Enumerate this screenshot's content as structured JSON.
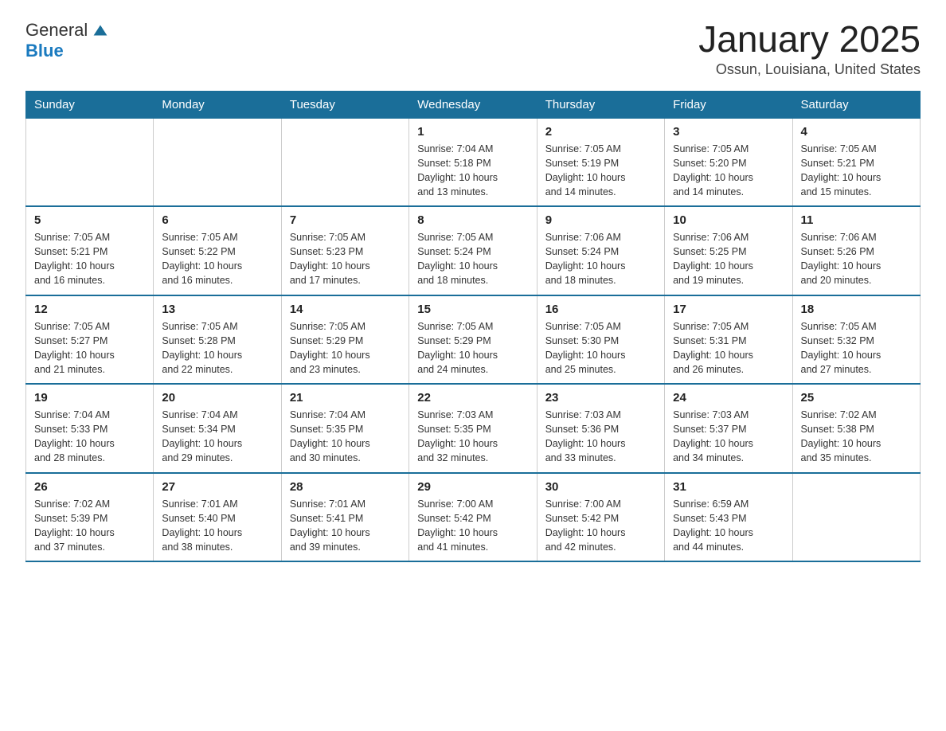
{
  "header": {
    "logo": {
      "line1": "General",
      "line2": "Blue"
    },
    "title": "January 2025",
    "location": "Ossun, Louisiana, United States"
  },
  "weekdays": [
    "Sunday",
    "Monday",
    "Tuesday",
    "Wednesday",
    "Thursday",
    "Friday",
    "Saturday"
  ],
  "weeks": [
    [
      {
        "day": "",
        "info": ""
      },
      {
        "day": "",
        "info": ""
      },
      {
        "day": "",
        "info": ""
      },
      {
        "day": "1",
        "info": "Sunrise: 7:04 AM\nSunset: 5:18 PM\nDaylight: 10 hours\nand 13 minutes."
      },
      {
        "day": "2",
        "info": "Sunrise: 7:05 AM\nSunset: 5:19 PM\nDaylight: 10 hours\nand 14 minutes."
      },
      {
        "day": "3",
        "info": "Sunrise: 7:05 AM\nSunset: 5:20 PM\nDaylight: 10 hours\nand 14 minutes."
      },
      {
        "day": "4",
        "info": "Sunrise: 7:05 AM\nSunset: 5:21 PM\nDaylight: 10 hours\nand 15 minutes."
      }
    ],
    [
      {
        "day": "5",
        "info": "Sunrise: 7:05 AM\nSunset: 5:21 PM\nDaylight: 10 hours\nand 16 minutes."
      },
      {
        "day": "6",
        "info": "Sunrise: 7:05 AM\nSunset: 5:22 PM\nDaylight: 10 hours\nand 16 minutes."
      },
      {
        "day": "7",
        "info": "Sunrise: 7:05 AM\nSunset: 5:23 PM\nDaylight: 10 hours\nand 17 minutes."
      },
      {
        "day": "8",
        "info": "Sunrise: 7:05 AM\nSunset: 5:24 PM\nDaylight: 10 hours\nand 18 minutes."
      },
      {
        "day": "9",
        "info": "Sunrise: 7:06 AM\nSunset: 5:24 PM\nDaylight: 10 hours\nand 18 minutes."
      },
      {
        "day": "10",
        "info": "Sunrise: 7:06 AM\nSunset: 5:25 PM\nDaylight: 10 hours\nand 19 minutes."
      },
      {
        "day": "11",
        "info": "Sunrise: 7:06 AM\nSunset: 5:26 PM\nDaylight: 10 hours\nand 20 minutes."
      }
    ],
    [
      {
        "day": "12",
        "info": "Sunrise: 7:05 AM\nSunset: 5:27 PM\nDaylight: 10 hours\nand 21 minutes."
      },
      {
        "day": "13",
        "info": "Sunrise: 7:05 AM\nSunset: 5:28 PM\nDaylight: 10 hours\nand 22 minutes."
      },
      {
        "day": "14",
        "info": "Sunrise: 7:05 AM\nSunset: 5:29 PM\nDaylight: 10 hours\nand 23 minutes."
      },
      {
        "day": "15",
        "info": "Sunrise: 7:05 AM\nSunset: 5:29 PM\nDaylight: 10 hours\nand 24 minutes."
      },
      {
        "day": "16",
        "info": "Sunrise: 7:05 AM\nSunset: 5:30 PM\nDaylight: 10 hours\nand 25 minutes."
      },
      {
        "day": "17",
        "info": "Sunrise: 7:05 AM\nSunset: 5:31 PM\nDaylight: 10 hours\nand 26 minutes."
      },
      {
        "day": "18",
        "info": "Sunrise: 7:05 AM\nSunset: 5:32 PM\nDaylight: 10 hours\nand 27 minutes."
      }
    ],
    [
      {
        "day": "19",
        "info": "Sunrise: 7:04 AM\nSunset: 5:33 PM\nDaylight: 10 hours\nand 28 minutes."
      },
      {
        "day": "20",
        "info": "Sunrise: 7:04 AM\nSunset: 5:34 PM\nDaylight: 10 hours\nand 29 minutes."
      },
      {
        "day": "21",
        "info": "Sunrise: 7:04 AM\nSunset: 5:35 PM\nDaylight: 10 hours\nand 30 minutes."
      },
      {
        "day": "22",
        "info": "Sunrise: 7:03 AM\nSunset: 5:35 PM\nDaylight: 10 hours\nand 32 minutes."
      },
      {
        "day": "23",
        "info": "Sunrise: 7:03 AM\nSunset: 5:36 PM\nDaylight: 10 hours\nand 33 minutes."
      },
      {
        "day": "24",
        "info": "Sunrise: 7:03 AM\nSunset: 5:37 PM\nDaylight: 10 hours\nand 34 minutes."
      },
      {
        "day": "25",
        "info": "Sunrise: 7:02 AM\nSunset: 5:38 PM\nDaylight: 10 hours\nand 35 minutes."
      }
    ],
    [
      {
        "day": "26",
        "info": "Sunrise: 7:02 AM\nSunset: 5:39 PM\nDaylight: 10 hours\nand 37 minutes."
      },
      {
        "day": "27",
        "info": "Sunrise: 7:01 AM\nSunset: 5:40 PM\nDaylight: 10 hours\nand 38 minutes."
      },
      {
        "day": "28",
        "info": "Sunrise: 7:01 AM\nSunset: 5:41 PM\nDaylight: 10 hours\nand 39 minutes."
      },
      {
        "day": "29",
        "info": "Sunrise: 7:00 AM\nSunset: 5:42 PM\nDaylight: 10 hours\nand 41 minutes."
      },
      {
        "day": "30",
        "info": "Sunrise: 7:00 AM\nSunset: 5:42 PM\nDaylight: 10 hours\nand 42 minutes."
      },
      {
        "day": "31",
        "info": "Sunrise: 6:59 AM\nSunset: 5:43 PM\nDaylight: 10 hours\nand 44 minutes."
      },
      {
        "day": "",
        "info": ""
      }
    ]
  ]
}
